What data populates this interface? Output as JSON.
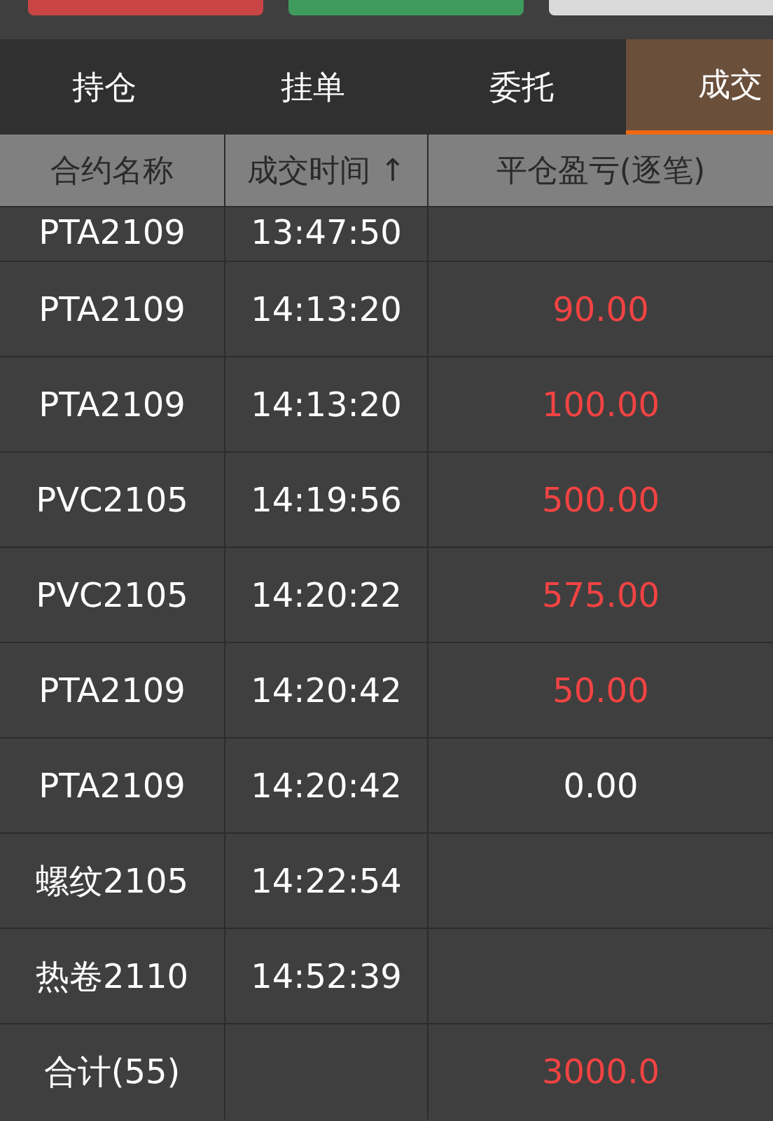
{
  "action_buttons": [
    {
      "color": "#c94545"
    },
    {
      "color": "#3f9a5d"
    },
    {
      "color": "#dadada"
    }
  ],
  "tabs": [
    {
      "label": "持仓",
      "selected": false
    },
    {
      "label": "挂单",
      "selected": false
    },
    {
      "label": "委托",
      "selected": false
    },
    {
      "label": "成交",
      "selected": true
    }
  ],
  "table": {
    "columns": [
      "合约名称",
      "成交时间 ↑",
      "平仓盈亏(逐笔)"
    ],
    "rows": [
      {
        "contract": "PTA2109",
        "time": "13:47:50",
        "pnl": ""
      },
      {
        "contract": "PTA2109",
        "time": "14:13:20",
        "pnl": "90.00",
        "positive": true
      },
      {
        "contract": "PTA2109",
        "time": "14:13:20",
        "pnl": "100.00",
        "positive": true
      },
      {
        "contract": "PVC2105",
        "time": "14:19:56",
        "pnl": "500.00",
        "positive": true
      },
      {
        "contract": "PVC2105",
        "time": "14:20:22",
        "pnl": "575.00",
        "positive": true
      },
      {
        "contract": "PTA2109",
        "time": "14:20:42",
        "pnl": "50.00",
        "positive": true
      },
      {
        "contract": "PTA2109",
        "time": "14:20:42",
        "pnl": "0.00",
        "positive": false
      },
      {
        "contract": "螺纹2105",
        "time": "14:22:54",
        "pnl": ""
      },
      {
        "contract": "热卷2110",
        "time": "14:52:39",
        "pnl": ""
      }
    ],
    "total": {
      "label": "合计(55)",
      "pnl": "3000.0",
      "positive": true
    }
  }
}
